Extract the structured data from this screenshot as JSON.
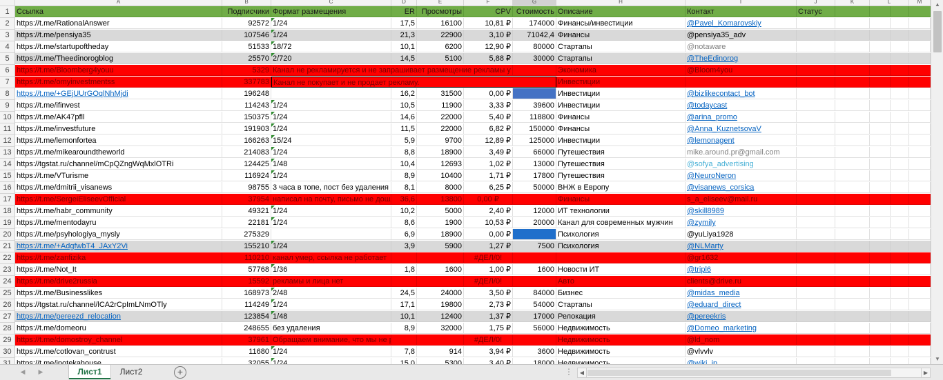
{
  "columns": [
    "A",
    "B",
    "C",
    "D",
    "E",
    "F",
    "G",
    "H",
    "I",
    "J",
    "K",
    "L",
    "M"
  ],
  "header": {
    "num": "1",
    "cells": [
      "Ссылка",
      "Подписчики",
      "Формат размещения",
      "ER",
      "Просмотры",
      "CPV",
      "Стоимость",
      "Описание",
      "Контакт",
      "Статус"
    ]
  },
  "rows": [
    {
      "n": "2",
      "style": "",
      "cells": [
        "https://t.me/RationalAnswer",
        "92572",
        "1/24",
        "17,5",
        "16100",
        "10,81 ₽",
        "174000",
        "Финансы/инвестиции",
        "@Pavel_Komarovskiy",
        ""
      ],
      "link": [
        false,
        false,
        false,
        false,
        false,
        false,
        false,
        false,
        true,
        false
      ]
    },
    {
      "n": "3",
      "style": "alt",
      "cells": [
        "https://t.me/pensiya35",
        "107546",
        "1/24",
        "21,3",
        "22900",
        "3,10 ₽",
        "71042,4",
        "Финансы",
        "@pensiya35_adv",
        ""
      ]
    },
    {
      "n": "4",
      "style": "",
      "cells": [
        "https://t.me/startupoftheday",
        "51533",
        "18/72",
        "10,1",
        "6200",
        "12,90 ₽",
        "80000",
        "Стартапы",
        "@notaware",
        ""
      ],
      "grey": [
        false,
        false,
        false,
        false,
        false,
        false,
        false,
        false,
        true,
        false
      ]
    },
    {
      "n": "5",
      "style": "alt",
      "cells": [
        "https://t.me/Theedinorogblog",
        "25570",
        "2/720",
        "14,5",
        "5100",
        "5,88 ₽",
        "30000",
        "Стартапы",
        "@TheEdinorog",
        ""
      ],
      "link": [
        false,
        false,
        false,
        false,
        false,
        false,
        false,
        false,
        true,
        false
      ]
    },
    {
      "n": "6",
      "style": "red",
      "cells": [
        "https://t.me/Bloomberg4youu",
        "5329",
        "Канал не рекламируется и не запрашивает размещение рекламы у себя!",
        "",
        "",
        "",
        "",
        "Экономика",
        "@Bloom4you",
        ""
      ],
      "span": "fmt"
    },
    {
      "n": "7",
      "style": "red",
      "cells": [
        "https://t.me/omyinvestmentss",
        "337783",
        "Канал не покупает и не продает рекламу.",
        "",
        "",
        "",
        "",
        "Инвестиции",
        "",
        ""
      ],
      "span": "fmtbox"
    },
    {
      "n": "8",
      "style": "",
      "cells": [
        "https://t.me/+GEjUUrGOqlNhMjdi",
        "196248",
        "",
        "16,2",
        "31500",
        "0,00 ₽",
        "",
        "Инвестиции",
        "@bizlikecontact_bot",
        ""
      ],
      "link": [
        true,
        false,
        false,
        false,
        false,
        false,
        false,
        false,
        true,
        false
      ],
      "blue": "cost"
    },
    {
      "n": "9",
      "style": "",
      "cells": [
        "https://t.me/ifinvest",
        "114243",
        "1/24",
        "10,5",
        "11900",
        "3,33 ₽",
        "39600",
        "Инвестиции",
        "@todaycast",
        ""
      ],
      "link": [
        false,
        false,
        false,
        false,
        false,
        false,
        false,
        false,
        true,
        false
      ]
    },
    {
      "n": "10",
      "style": "",
      "cells": [
        "https://t.me/AK47pfll",
        "150375",
        "1/24",
        "14,6",
        "22000",
        "5,40 ₽",
        "118800",
        "Финансы",
        "@arina_promo",
        ""
      ],
      "link": [
        false,
        false,
        false,
        false,
        false,
        false,
        false,
        false,
        true,
        false
      ]
    },
    {
      "n": "11",
      "style": "",
      "cells": [
        "https://t.me/investfuture",
        "191903",
        "1/24",
        "11,5",
        "22000",
        "6,82 ₽",
        "150000",
        "Финансы",
        "@Anna_KuznetsovaV",
        ""
      ],
      "link": [
        false,
        false,
        false,
        false,
        false,
        false,
        false,
        false,
        true,
        false
      ]
    },
    {
      "n": "12",
      "style": "",
      "cells": [
        "https://t.me/lemonfortea",
        "166263",
        "15/24",
        "5,9",
        "9700",
        "12,89 ₽",
        "125000",
        "Инвестиции",
        "@lemonagent",
        ""
      ],
      "link": [
        false,
        false,
        false,
        false,
        false,
        false,
        false,
        false,
        true,
        false
      ]
    },
    {
      "n": "13",
      "style": "",
      "cells": [
        "https://t.me/mikearoundtheworld",
        "214083",
        "1/24",
        "8,8",
        "18900",
        "3,49 ₽",
        "66000",
        "Путешествия",
        "mike.around.pr@gmail.com",
        ""
      ],
      "grey": [
        false,
        false,
        false,
        false,
        false,
        false,
        false,
        false,
        true,
        false
      ]
    },
    {
      "n": "14",
      "style": "",
      "cells": [
        "https://tgstat.ru/channel/mCpQZngWqMxlOTRi",
        "124425",
        "1/48",
        "10,4",
        "12693",
        "1,02 ₽",
        "13000",
        "Путешествия",
        "@sofya_advertising",
        ""
      ],
      "light": [
        false,
        false,
        false,
        false,
        false,
        false,
        false,
        false,
        true,
        false
      ]
    },
    {
      "n": "15",
      "style": "",
      "cells": [
        "https://t.me/VTurisme",
        "116924",
        "1/24",
        "8,9",
        "10400",
        "1,71 ₽",
        "17800",
        "Путешествия",
        "@NeuroNeron",
        ""
      ],
      "link": [
        false,
        false,
        false,
        false,
        false,
        false,
        false,
        false,
        true,
        false
      ]
    },
    {
      "n": "16",
      "style": "",
      "cells": [
        "https://t.me/dmitrii_visanews",
        "98755",
        "3 часа в топе, пост без удаления",
        "8,1",
        "8000",
        "6,25 ₽",
        "50000",
        "ВНЖ в Европу",
        "@visanews_corsica",
        ""
      ],
      "link": [
        false,
        false,
        false,
        false,
        false,
        false,
        false,
        false,
        true,
        false
      ]
    },
    {
      "n": "17",
      "style": "red",
      "cells": [
        "https://t.me/SergeiEliseevOfficial",
        "37954",
        "написал на почту, письмо не дошло",
        "36,6",
        "13800",
        "0,00 ₽",
        "",
        "Финансы",
        "s_a_eliseev@mail.ru",
        ""
      ]
    },
    {
      "n": "18",
      "style": "",
      "cells": [
        "https://t.me/habr_community",
        "49321",
        "1/24",
        "10,2",
        "5000",
        "2,40 ₽",
        "12000",
        "ИТ технологии",
        "@skill8989",
        ""
      ],
      "link": [
        false,
        false,
        false,
        false,
        false,
        false,
        false,
        false,
        true,
        false
      ]
    },
    {
      "n": "19",
      "style": "",
      "cells": [
        "https://t.me/mentodayru",
        "22181",
        "1/24",
        "8,6",
        "1900",
        "10,53 ₽",
        "20000",
        "Канал для современных мужчин",
        "@zymily",
        ""
      ],
      "link": [
        false,
        false,
        false,
        false,
        false,
        false,
        false,
        false,
        true,
        false
      ]
    },
    {
      "n": "20",
      "style": "",
      "cells": [
        "https://t.me/psyhologiya_mysly",
        "275329",
        "",
        "6,9",
        "18900",
        "0,00 ₽",
        "",
        "Психология",
        "@yuLiya1928",
        ""
      ],
      "blue": "cost2"
    },
    {
      "n": "21",
      "style": "alt",
      "cells": [
        "https://t.me/+AdgfwbT4_JAxY2Vi",
        "155210",
        "1/24",
        "3,9",
        "5900",
        "1,27 ₽",
        "7500",
        "Психология",
        "@NLMarty",
        ""
      ],
      "link": [
        true,
        false,
        false,
        false,
        false,
        false,
        false,
        false,
        true,
        false
      ]
    },
    {
      "n": "22",
      "style": "red",
      "cells": [
        "https://t.me/zanfizika",
        "110210",
        "канал умер, ссылка не работает",
        "",
        "",
        "#ДЕЛ/0!",
        "",
        "",
        "@gr1632",
        ""
      ],
      "link": [
        false,
        false,
        false,
        false,
        false,
        false,
        false,
        false,
        true,
        false
      ]
    },
    {
      "n": "23",
      "style": "",
      "cells": [
        "https://t.me/Not_It",
        "57768",
        "1/36",
        "1,8",
        "1600",
        "1,00 ₽",
        "1600",
        "Новости ИТ",
        "@tripl6",
        ""
      ],
      "link": [
        false,
        false,
        false,
        false,
        false,
        false,
        false,
        false,
        true,
        false
      ]
    },
    {
      "n": "24",
      "style": "red",
      "cells": [
        "https://t.me/drive2russia",
        "15592",
        "рекламы и лица нет",
        "",
        "",
        "#ДЕЛ/0!",
        "",
        "Авто",
        "clients@drive.ru",
        ""
      ]
    },
    {
      "n": "25",
      "style": "",
      "cells": [
        "https://t.me/Businesslikes",
        "168973",
        "2/48",
        "24,5",
        "24000",
        "3,50 ₽",
        "84000",
        "Бизнес",
        "@midas_media",
        ""
      ],
      "link": [
        false,
        false,
        false,
        false,
        false,
        false,
        false,
        false,
        true,
        false
      ]
    },
    {
      "n": "26",
      "style": "",
      "cells": [
        "https://tgstat.ru/channel/lCA2rCpImLNmOTly",
        "114249",
        "1/24",
        "17,1",
        "19800",
        "2,73 ₽",
        "54000",
        "Стартапы",
        "@eduard_direct",
        ""
      ],
      "link": [
        false,
        false,
        false,
        false,
        false,
        false,
        false,
        false,
        true,
        false
      ]
    },
    {
      "n": "27",
      "style": "alt",
      "cells": [
        "https://t.me/pereezd_relocation",
        "123854",
        "1/48",
        "10,1",
        "12400",
        "1,37 ₽",
        "17000",
        "Релокация",
        "@pereekris",
        ""
      ],
      "link": [
        true,
        false,
        false,
        false,
        false,
        false,
        false,
        false,
        true,
        false
      ]
    },
    {
      "n": "28",
      "style": "",
      "cells": [
        "https://t.me/domeoru",
        "248655",
        "без удаления",
        "8,9",
        "32000",
        "1,75 ₽",
        "56000",
        "Недвижимость",
        "@Domeo_marketing",
        ""
      ],
      "link": [
        false,
        false,
        false,
        false,
        false,
        false,
        false,
        false,
        true,
        false
      ]
    },
    {
      "n": "29",
      "style": "red",
      "cells": [
        "https://t.me/domostroy_channel",
        "37961",
        "Обращаем внимание, что мы не рекламируем телеграм-каналы",
        "",
        "",
        "#ДЕЛ/0!",
        "",
        "Недвижимость",
        "@ld_nom",
        ""
      ]
    },
    {
      "n": "30",
      "style": "",
      "cells": [
        "https://t.me/cotlovan_contrust",
        "11680",
        "1/24",
        "7,8",
        "914",
        "3,94 ₽",
        "3600",
        "Недвижимость",
        "@vlvvlv",
        ""
      ]
    },
    {
      "n": "31",
      "style": "",
      "cells": [
        "https://t.me/ipotekahouse",
        "32055",
        "1/24",
        "15,0",
        "5300",
        "3,40 ₽",
        "18000",
        "Недвижимость",
        "@wiki_ip",
        ""
      ],
      "link": [
        false,
        false,
        false,
        false,
        false,
        false,
        false,
        false,
        true,
        false
      ]
    }
  ],
  "tabs": {
    "sheet1": "Лист1",
    "sheet2": "Лист2",
    "add": "+"
  },
  "colors": {
    "header_green": "#70ad47",
    "row_red": "#ff0000",
    "cell_blue": "#4472c4",
    "active_tab": "#217346"
  }
}
